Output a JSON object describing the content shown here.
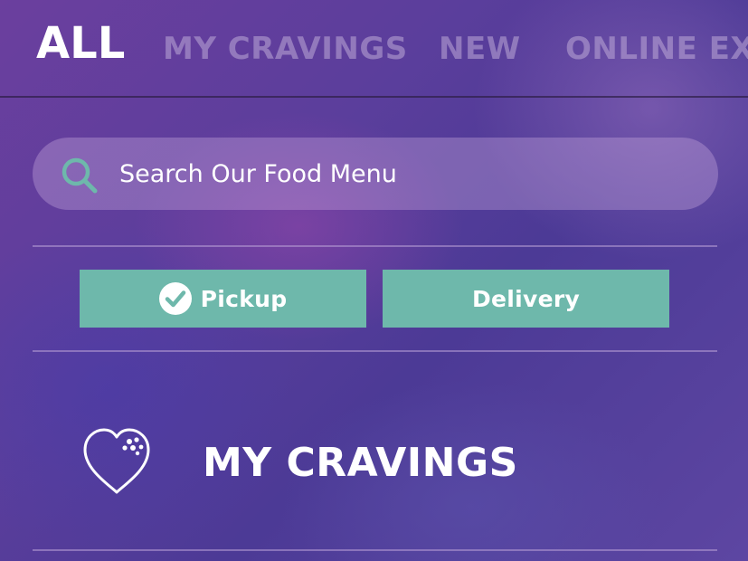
{
  "nav": {
    "tabs": [
      {
        "label": "ALL",
        "active": true
      },
      {
        "label": "MY CRAVINGS",
        "active": false
      },
      {
        "label": "NEW",
        "active": false
      },
      {
        "label": "ONLINE EX",
        "active": false
      }
    ]
  },
  "search": {
    "placeholder": "Search Our Food Menu",
    "value": "",
    "icon": "search-icon"
  },
  "order_type": {
    "pickup_label": "Pickup",
    "delivery_label": "Delivery",
    "selected": "Pickup",
    "selected_icon": "check-circle-icon"
  },
  "cravings": {
    "title": "MY CRAVINGS",
    "icon": "heart-icon"
  },
  "colors": {
    "accent": "#6eb8ab",
    "background": "#5b3e9c",
    "text": "#ffffff"
  }
}
